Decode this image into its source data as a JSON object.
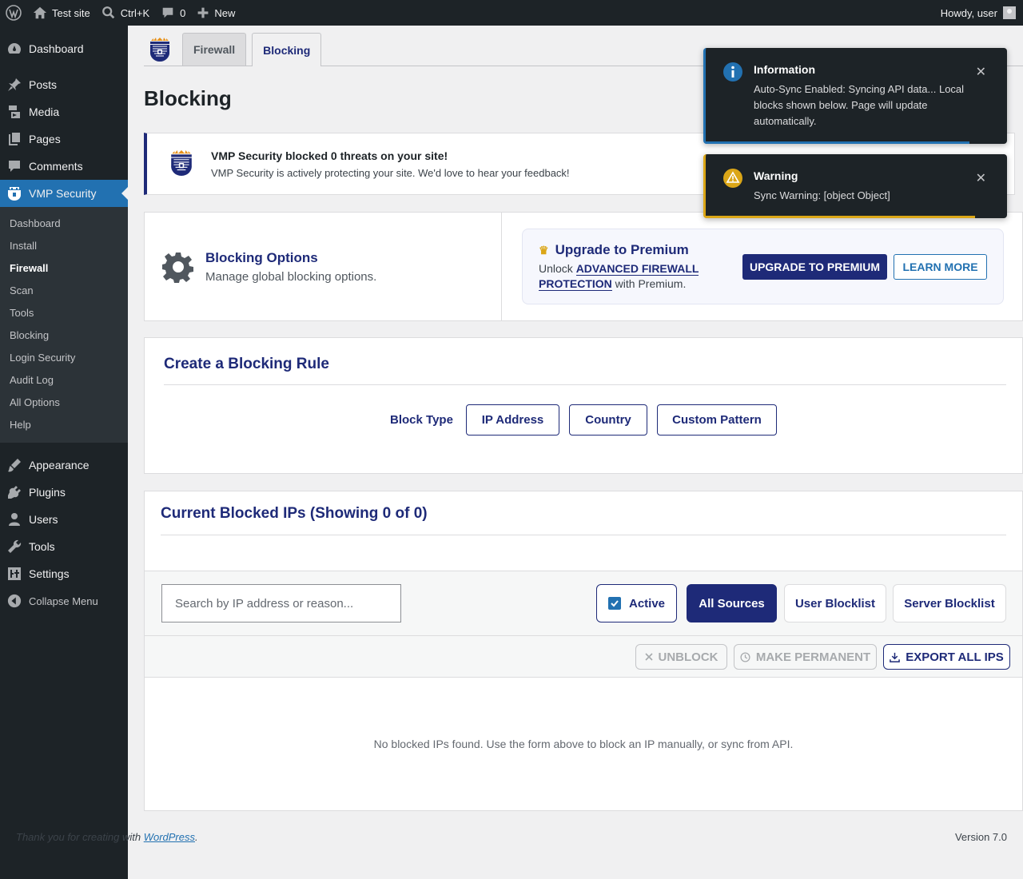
{
  "adminbar": {
    "site_name": "Test site",
    "search_shortcut": "Ctrl+K",
    "comments_count": "0",
    "new_label": "New",
    "howdy": "Howdy, user"
  },
  "sidebar": {
    "items_top": [
      {
        "label": "Dashboard",
        "icon": "dashboard-icon"
      },
      {
        "label": "Posts",
        "icon": "pin-icon"
      },
      {
        "label": "Media",
        "icon": "media-icon"
      },
      {
        "label": "Pages",
        "icon": "pages-icon"
      },
      {
        "label": "Comments",
        "icon": "comment-icon"
      },
      {
        "label": "VMP Security",
        "icon": "shield-icon"
      }
    ],
    "submenu": [
      "Dashboard",
      "Install",
      "Firewall",
      "Scan",
      "Tools",
      "Blocking",
      "Login Security",
      "Audit Log",
      "All Options",
      "Help"
    ],
    "items_bottom": [
      {
        "label": "Appearance",
        "icon": "brush-icon"
      },
      {
        "label": "Plugins",
        "icon": "plug-icon"
      },
      {
        "label": "Users",
        "icon": "user-icon"
      },
      {
        "label": "Tools",
        "icon": "wrench-icon"
      },
      {
        "label": "Settings",
        "icon": "settings-icon"
      }
    ],
    "collapse": "Collapse Menu"
  },
  "tabs": [
    {
      "label": "Firewall"
    },
    {
      "label": "Blocking"
    }
  ],
  "page_title": "Blocking",
  "notice": {
    "title": "VMP Security blocked 0 threats on your site!",
    "subtitle": "VMP Security is actively protecting your site. We'd love to hear your feedback!"
  },
  "options": {
    "title": "Blocking Options",
    "subtitle": "Manage global blocking options.",
    "premium_title": "Upgrade to Premium",
    "premium_pre": "Unlock ",
    "premium_highlight": "ADVANCED FIREWALL PROTECTION",
    "premium_post": " with Premium.",
    "upgrade_btn": "UPGRADE TO PREMIUM",
    "learn_btn": "LEARN MORE"
  },
  "rule": {
    "title": "Create a Blocking Rule",
    "block_type_label": "Block Type",
    "types": [
      "IP Address",
      "Country",
      "Custom Pattern"
    ]
  },
  "ips": {
    "title": "Current Blocked IPs (Showing 0 of 0)",
    "search_placeholder": "Search by IP address or reason...",
    "active_label": "Active",
    "sources": [
      "All Sources",
      "User Blocklist",
      "Server Blocklist"
    ],
    "unblock": "UNBLOCK",
    "make_permanent": "MAKE PERMANENT",
    "export": "EXPORT ALL IPS",
    "empty": "No blocked IPs found. Use the form above to block an IP manually, or sync from API."
  },
  "footer": {
    "thanks_pre": "Thank you for creating with ",
    "wp_link": "WordPress",
    "thanks_post": ".",
    "version": "Version 7.0"
  },
  "toasts": {
    "info_title": "Information",
    "info_msg": "Auto-Sync Enabled: Syncing API data... Local blocks shown below. Page will update automatically.",
    "warn_title": "Warning",
    "warn_msg": "Sync Warning: [object Object]"
  },
  "colors": {
    "brand": "#1e2a78",
    "wp_blue": "#2271b1",
    "warning": "#dba617"
  }
}
